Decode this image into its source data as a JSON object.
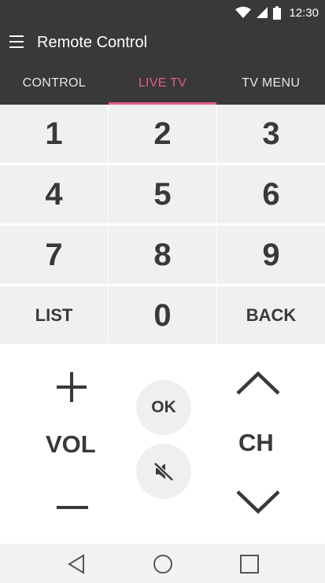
{
  "status_bar": {
    "time": "12:30"
  },
  "app_bar": {
    "title": "Remote Control"
  },
  "tabs": [
    {
      "label": "CONTROL",
      "active": false
    },
    {
      "label": "LIVE TV",
      "active": true
    },
    {
      "label": "TV MENU",
      "active": false
    }
  ],
  "keypad": {
    "keys": [
      "1",
      "2",
      "3",
      "4",
      "5",
      "6",
      "7",
      "8",
      "9",
      "LIST",
      "0",
      "BACK"
    ]
  },
  "controls": {
    "volume_label": "VOL",
    "channel_label": "CH",
    "ok_label": "OK"
  },
  "colors": {
    "app_bar": "#393939",
    "accent": "#e45b86",
    "key_background": "#f0f0f0",
    "text": "#393939"
  }
}
